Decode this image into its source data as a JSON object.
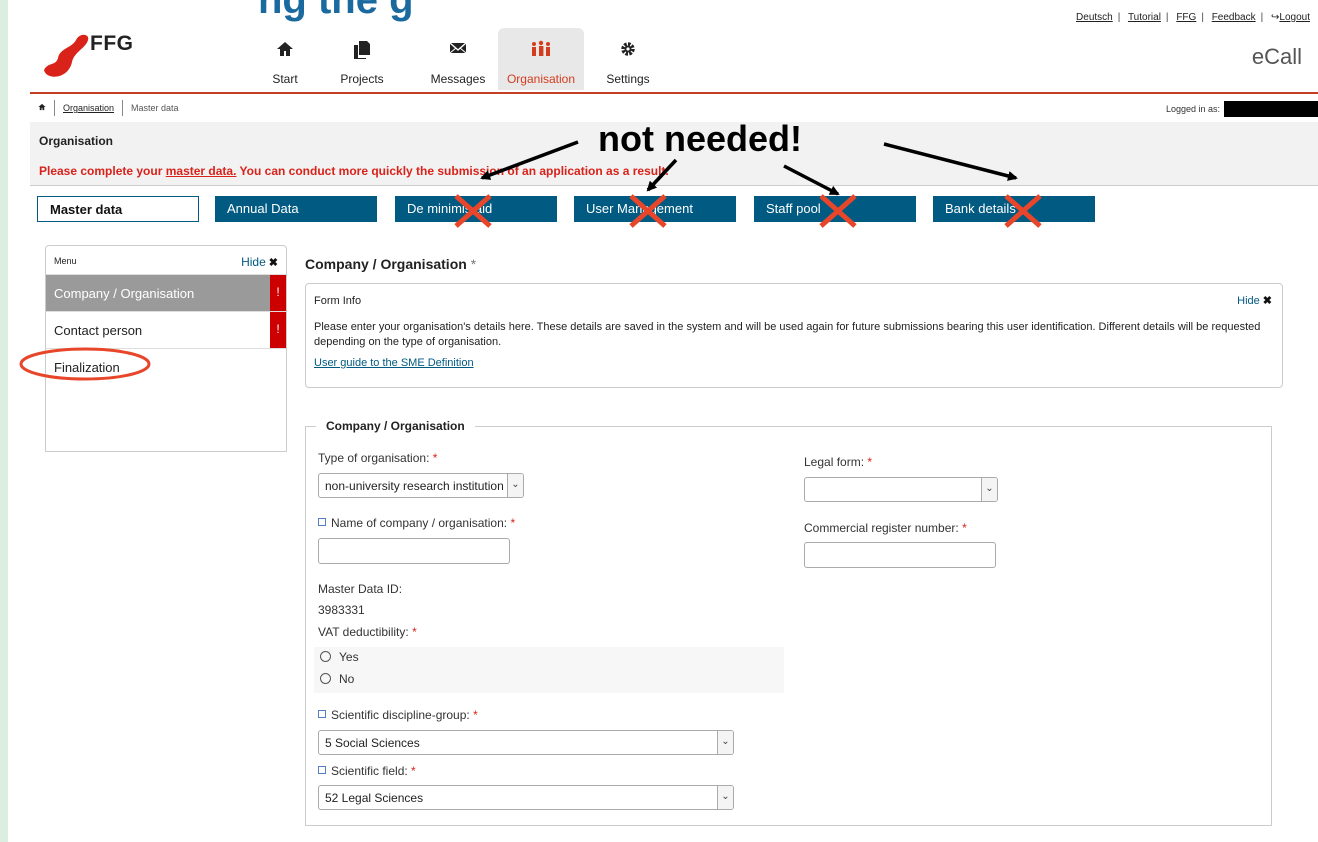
{
  "slide": {
    "headline": "ng the g"
  },
  "header": {
    "top_links": [
      "Deutsch",
      "Tutorial",
      "FFG",
      "Feedback",
      "Logout"
    ],
    "logo_text": "FFG",
    "app_name": "eCall",
    "nav": [
      {
        "label": "Start",
        "icon": "home-icon"
      },
      {
        "label": "Projects",
        "icon": "documents-icon"
      },
      {
        "label": "Messages",
        "icon": "envelope-icon"
      },
      {
        "label": "Organisation",
        "icon": "people-icon",
        "active": true
      },
      {
        "label": "Settings",
        "icon": "gear-icon"
      }
    ],
    "accent_color": "#c33e23"
  },
  "breadcrumb": {
    "home_icon": "home-icon",
    "items": [
      "Organisation",
      "Master data"
    ]
  },
  "logged_in_label": "Logged in as:",
  "org": {
    "title": "Organisation",
    "message_pre": "Please complete your ",
    "message_link": "master data.",
    "message_post": " You can conduct more quickly the submission of an application as a result."
  },
  "tabs": [
    {
      "label": "Master data",
      "active": true
    },
    {
      "label": "Annual Data"
    },
    {
      "label": "De minimis aid"
    },
    {
      "label": "User Management"
    },
    {
      "label": "Staff pool"
    },
    {
      "label": "Bank details"
    }
  ],
  "menu": {
    "title": "Menu",
    "hide": "Hide",
    "items": [
      {
        "label": "Company / Organisation",
        "flag": "!"
      },
      {
        "label": "Contact person",
        "flag": "!"
      },
      {
        "label": "Finalization"
      }
    ]
  },
  "main": {
    "title": "Company / Organisation",
    "required_mark": "*",
    "form_info": {
      "label": "Form Info",
      "hide": "Hide",
      "text": "Please enter your organisation's details here. These details are saved in the system and will be used again for future submissions bearing this user identification. Different details will be requested depending on the type of organisation.",
      "link": "User guide to the SME Definition"
    },
    "fieldset": {
      "legend": "Company / Organisation",
      "type_label": "Type of organisation:",
      "type_value": "non-university research institution",
      "name_label": "Name of company / organisation:",
      "name_value": "",
      "master_id_label": "Master Data ID:",
      "master_id_value": "3983331",
      "vat_label": "VAT deductibility:",
      "vat_options": [
        "Yes",
        "No"
      ],
      "discipline_label": "Scientific discipline-group:",
      "discipline_value": "5 Social Sciences",
      "field_label": "Scientific field:",
      "field_value": "52 Legal Sciences",
      "legal_form_label": "Legal form:",
      "legal_form_value": "",
      "register_label": "Commercial register number:",
      "register_value": ""
    }
  },
  "annotation": {
    "text": "not needed!",
    "cross_color": "#e8462a",
    "circle_color": "#e8462a"
  }
}
